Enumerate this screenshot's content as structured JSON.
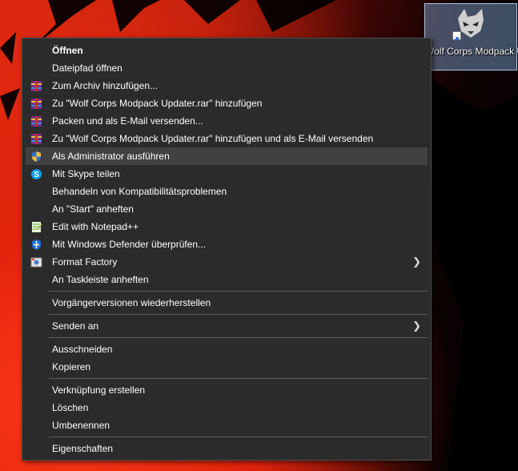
{
  "desktop_icon": {
    "label": "Wolf Corps Modpack Updater",
    "icon": "wolf-icon"
  },
  "menu": {
    "groups": [
      [
        {
          "label": "Öffnen",
          "bold": true,
          "icon": null
        },
        {
          "label": "Dateipfad öffnen",
          "icon": null
        },
        {
          "label": "Zum Archiv hinzufügen...",
          "icon": "winrar-icon"
        },
        {
          "label": "Zu \"Wolf Corps Modpack Updater.rar\" hinzufügen",
          "icon": "winrar-icon"
        },
        {
          "label": "Packen und als E-Mail versenden...",
          "icon": "winrar-icon"
        },
        {
          "label": "Zu \"Wolf Corps Modpack Updater.rar\" hinzufügen und als E-Mail versenden",
          "icon": "winrar-icon"
        },
        {
          "label": "Als Administrator ausführen",
          "icon": "uac-shield-icon",
          "hover": true
        },
        {
          "label": "Mit Skype teilen",
          "icon": "skype-icon"
        },
        {
          "label": "Behandeln von Kompatibilitätsproblemen",
          "icon": null
        },
        {
          "label": "An \"Start\" anheften",
          "icon": null
        },
        {
          "label": "Edit with Notepad++",
          "icon": "notepadpp-icon"
        },
        {
          "label": "Mit Windows Defender überprüfen...",
          "icon": "defender-icon"
        },
        {
          "label": "Format Factory",
          "icon": "format-factory-icon",
          "submenu": true
        },
        {
          "label": "An Taskleiste anheften",
          "icon": null
        }
      ],
      [
        {
          "label": "Vorgängerversionen wiederherstellen",
          "icon": null
        }
      ],
      [
        {
          "label": "Senden an",
          "icon": null,
          "submenu": true
        }
      ],
      [
        {
          "label": "Ausschneiden",
          "icon": null
        },
        {
          "label": "Kopieren",
          "icon": null
        }
      ],
      [
        {
          "label": "Verknüpfung erstellen",
          "icon": null
        },
        {
          "label": "Löschen",
          "icon": null
        },
        {
          "label": "Umbenennen",
          "icon": null
        }
      ],
      [
        {
          "label": "Eigenschaften",
          "icon": null
        }
      ]
    ],
    "submenu_glyph": "❯"
  }
}
